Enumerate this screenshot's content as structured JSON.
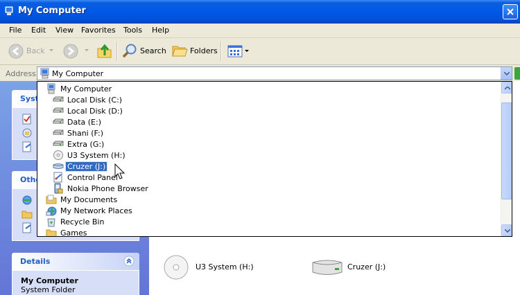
{
  "window": {
    "title": "My Computer"
  },
  "menu": [
    "File",
    "Edit",
    "View",
    "Favorites",
    "Tools",
    "Help"
  ],
  "toolbar": {
    "back_label": "Back",
    "search_label": "Search",
    "folders_label": "Folders"
  },
  "address": {
    "label": "Address",
    "value": "My Computer"
  },
  "dropdown": {
    "items": [
      {
        "label": "My Computer",
        "icon": "computer-icon"
      },
      {
        "label": "Local Disk (C:)",
        "icon": "hard-drive-icon"
      },
      {
        "label": "Local Disk (D:)",
        "icon": "hard-drive-icon"
      },
      {
        "label": "Data (E:)",
        "icon": "hard-drive-icon"
      },
      {
        "label": "Shani (F:)",
        "icon": "hard-drive-icon"
      },
      {
        "label": "Extra (G:)",
        "icon": "hard-drive-icon"
      },
      {
        "label": "U3 System (H:)",
        "icon": "cd-drive-icon"
      },
      {
        "label": "Cruzer (J:)",
        "icon": "removable-drive-icon",
        "selected": true
      },
      {
        "label": "Control Panel",
        "icon": "control-panel-icon"
      },
      {
        "label": "Nokia Phone Browser",
        "icon": "phone-browser-icon"
      },
      {
        "label": "My Documents",
        "icon": "documents-folder-icon"
      },
      {
        "label": "My Network Places",
        "icon": "network-places-icon"
      },
      {
        "label": "Recycle Bin",
        "icon": "recycle-bin-icon"
      },
      {
        "label": "Games",
        "icon": "folder-icon"
      }
    ]
  },
  "taskpane": {
    "system_tasks_title": "Syst",
    "other_places_title": "Othe",
    "details": {
      "title": "Details",
      "name": "My Computer",
      "type": "System Folder"
    }
  },
  "content": {
    "items": [
      {
        "label": "U3 System (H:)",
        "icon": "cd-drive-icon"
      },
      {
        "label": "Cruzer (J:)",
        "icon": "removable-drive-icon"
      }
    ]
  }
}
